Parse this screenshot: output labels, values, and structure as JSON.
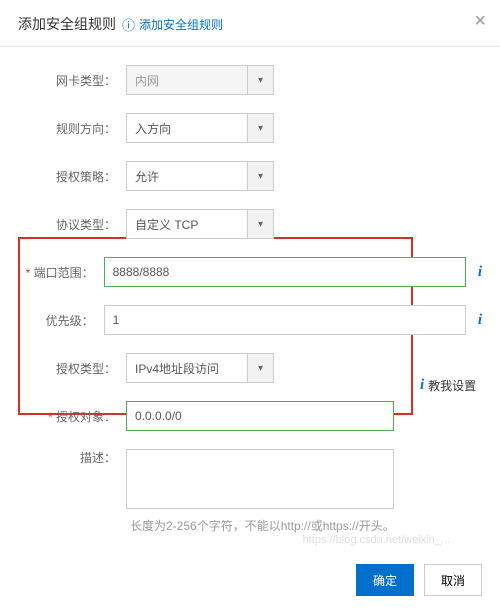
{
  "header": {
    "title": "添加安全组规则",
    "subtitle": "添加安全组规则"
  },
  "fields": {
    "nic_type": {
      "label": "网卡类型",
      "value": "内网"
    },
    "direction": {
      "label": "规则方向",
      "value": "入方向"
    },
    "policy": {
      "label": "授权策略",
      "value": "允许"
    },
    "protocol": {
      "label": "协议类型",
      "value": "自定义 TCP"
    },
    "port_range": {
      "label": "端口范围",
      "value": "8888/8888"
    },
    "priority": {
      "label": "优先级",
      "value": "1"
    },
    "auth_type": {
      "label": "授权类型",
      "value": "IPv4地址段访问"
    },
    "auth_object": {
      "label": "授权对象",
      "value": "0.0.0.0/0"
    },
    "description": {
      "label": "描述",
      "value": ""
    }
  },
  "hint": "长度为2-256个字符，不能以http://或https://开头。",
  "side_hint": "教我设置",
  "buttons": {
    "ok": "确定",
    "cancel": "取消"
  },
  "watermark": "https://blog.csdn.net/weixin_..."
}
